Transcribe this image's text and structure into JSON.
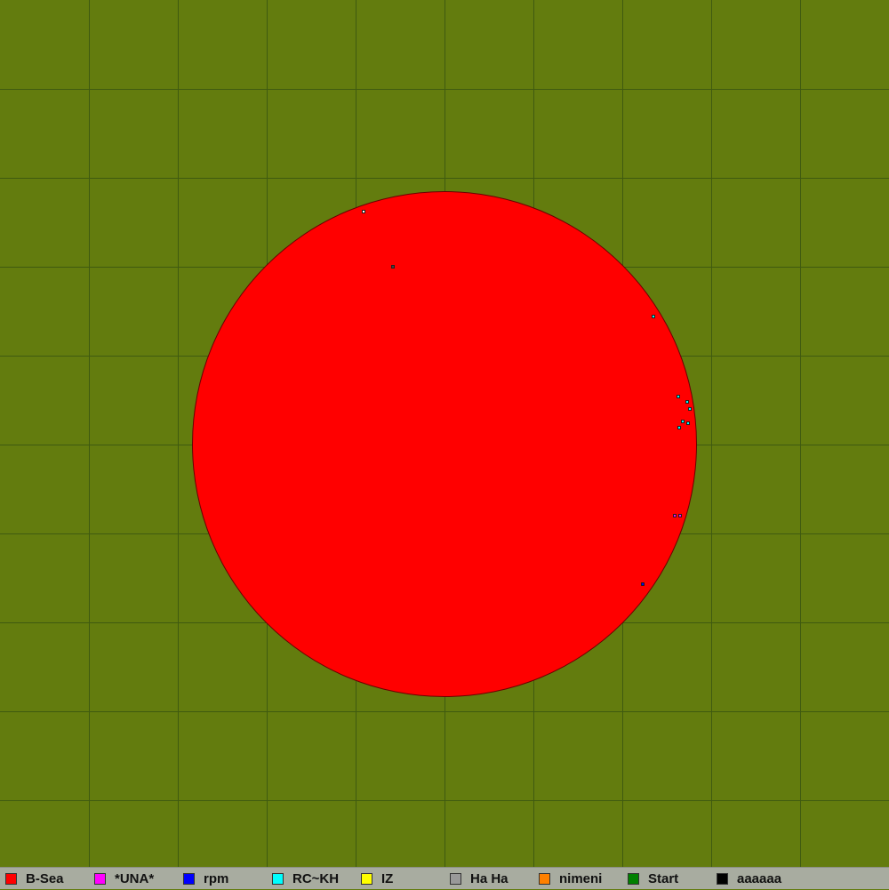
{
  "map": {
    "background_color": "#637c0e",
    "territory_color": "#ff0000",
    "territory_owner": "B-Sea"
  },
  "legend": {
    "players": [
      {
        "name": "B-Sea",
        "color": "#ff0000"
      },
      {
        "name": "*UNA*",
        "color": "#ff00ff"
      },
      {
        "name": "rpm",
        "color": "#0000ff"
      },
      {
        "name": "RC~KH",
        "color": "#00ffff"
      },
      {
        "name": "IZ",
        "color": "#ffff00"
      },
      {
        "name": "Ha Ha",
        "color": "#999999"
      },
      {
        "name": "nimeni",
        "color": "#ff8000"
      },
      {
        "name": "Start",
        "color": "#008000"
      },
      {
        "name": "aaaaaa",
        "color": "#000000"
      }
    ]
  }
}
